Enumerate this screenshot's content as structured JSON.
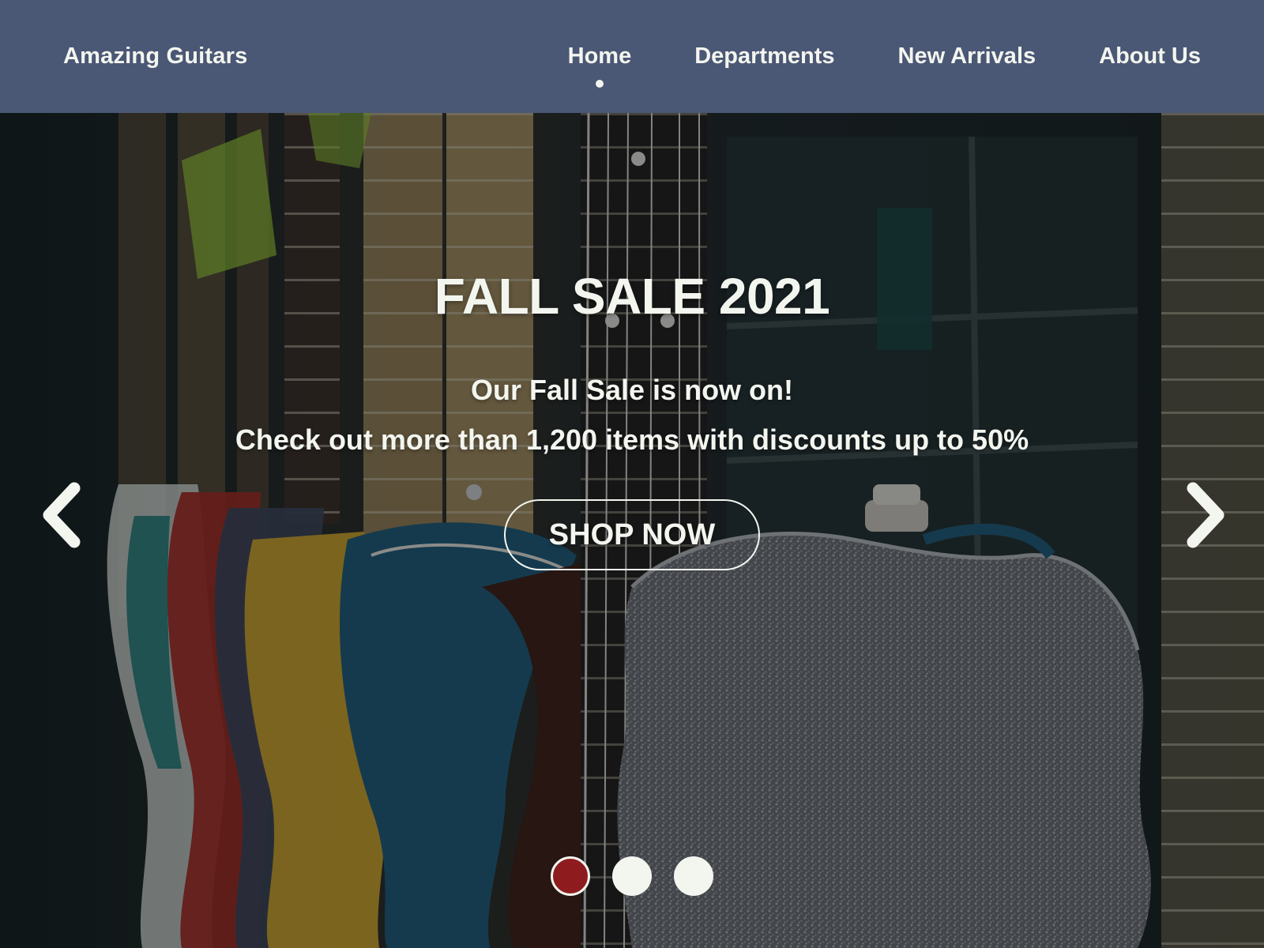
{
  "header": {
    "brand": "Amazing Guitars",
    "nav": [
      {
        "label": "Home",
        "active": true
      },
      {
        "label": "Departments",
        "active": false
      },
      {
        "label": "New Arrivals",
        "active": false
      },
      {
        "label": "About Us",
        "active": false
      }
    ]
  },
  "hero": {
    "title": "FALL SALE 2021",
    "line1": "Our Fall Sale is now on!",
    "line2": "Check out more than 1,200 items with discounts up to 50%",
    "cta_label": "SHOP NOW",
    "prev_icon": "chevron-left-icon",
    "next_icon": "chevron-right-icon",
    "slides": {
      "count": 3,
      "active_index": 0
    }
  },
  "colors": {
    "header_bg": "#4a5775",
    "text": "#f3f5ef",
    "active_dot": "#8e1c1e"
  }
}
